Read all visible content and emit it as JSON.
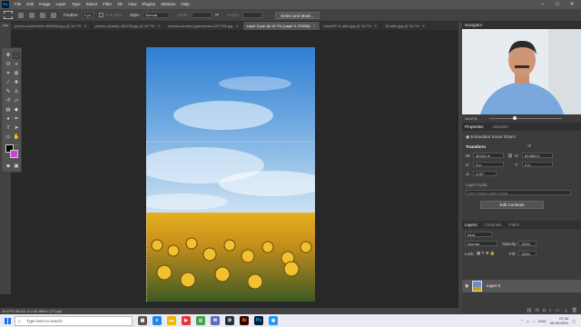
{
  "app": {
    "logo": "Ps",
    "menu": [
      "File",
      "Edit",
      "Image",
      "Layer",
      "Type",
      "Select",
      "Filter",
      "3D",
      "View",
      "Plugins",
      "Window",
      "Help"
    ],
    "window_controls": [
      "–",
      "□",
      "✕"
    ]
  },
  "options_bar": {
    "feather_label": "Feather:",
    "feather_value": "0 px",
    "anti_alias_label": "Anti-alias",
    "style_label": "Style:",
    "style_value": "Normal",
    "width_label": "Width:",
    "height_label": "Height:",
    "select_mask_button": "Select and Mask..."
  },
  "tabs": [
    {
      "label": "pexels-contenhive-4065864.jpg @ 16.7%",
      "active": false
    },
    {
      "label": "pexels-pixabay-462235.jpg @ 16.7%",
      "active": false
    },
    {
      "label": "pexels-karolina-grabowska-4207785.jpg",
      "active": false
    },
    {
      "label": "Layer 0.psb @ 16.7% (Layer 0, RGB/8)",
      "active": true
    },
    {
      "label": "kriisoft5 11 after.jpg @ 16.7%",
      "active": false
    },
    {
      "label": "38 after.jpg @ 16.7%",
      "active": false
    }
  ],
  "status_bar": {
    "zoom_and_doc": "16.67%   46.611 in x 69.889 in (72 ppi)"
  },
  "navigator": {
    "title": "Navigator",
    "zoom": "16.67%"
  },
  "properties": {
    "tab_properties": "Properties",
    "tab_libraries": "Libraries",
    "object_type": "Embedded Smart Object",
    "section_transform": "Transform",
    "w_label": "W:",
    "w_value": "46.611 in",
    "h_label": "H:",
    "h_value": "69.889 in",
    "x_label": "X:",
    "x_value": "0 in",
    "y_label": "Y:",
    "y_value": "0 in",
    "angle_value": "0.00°",
    "file_name": "Layer 0.psb",
    "layer_comp": "Don't Apply Layer Comp",
    "edit_contents_button": "Edit Contents"
  },
  "layers_panel": {
    "tab_layers": "Layers",
    "tab_channels": "Channels",
    "tab_paths": "Paths",
    "kind_filter": "Kind",
    "blend_mode": "Normal",
    "opacity_label": "Opacity:",
    "opacity_value": "100%",
    "lock_label": "Lock:",
    "fill_label": "Fill:",
    "fill_value": "100%",
    "layers": [
      {
        "name": "Layer 0",
        "visible": true
      }
    ]
  },
  "taskbar": {
    "search_placeholder": "Type here to search",
    "language": "ENG",
    "time": "07:34",
    "date": "25-09-2021"
  },
  "colors": {
    "foreground": "#000000",
    "background": "#cf3fd6",
    "accent": "#31a8ff"
  }
}
